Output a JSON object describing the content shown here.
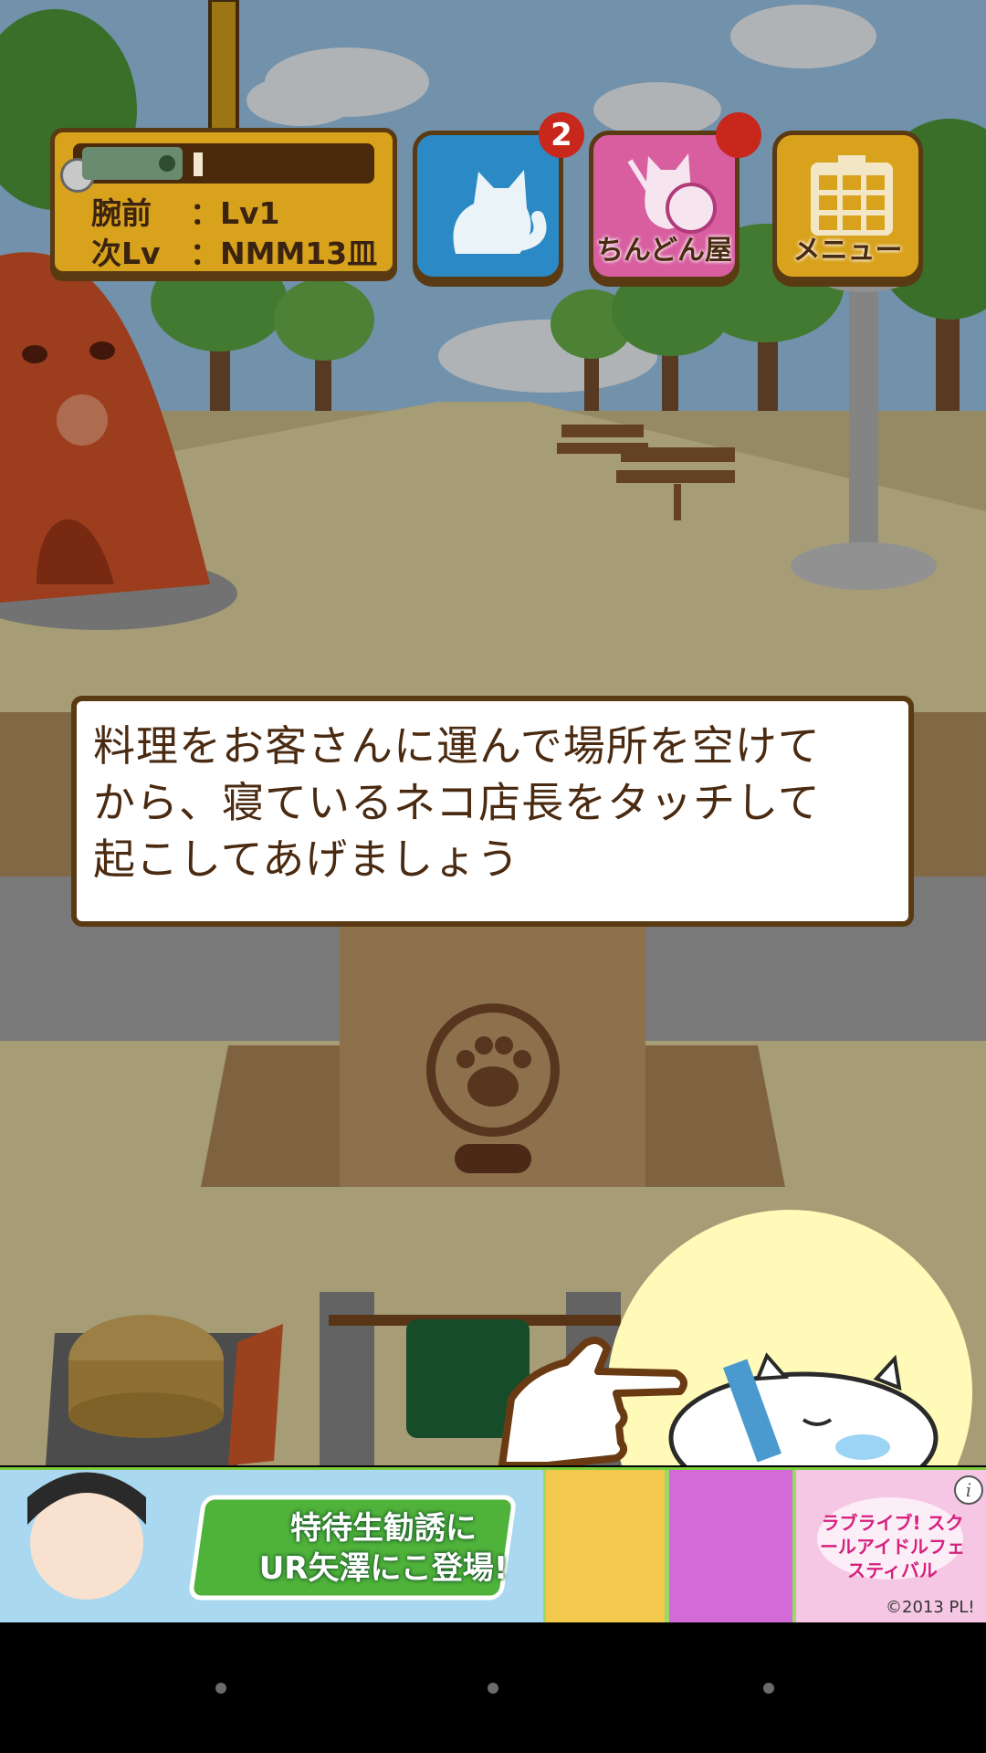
{
  "hud": {
    "status_panel": {
      "skill_label": "腕前",
      "skill_value": "：Lv1",
      "next_label": "次Lv",
      "next_value": "：NMM13皿"
    },
    "cat_button": {
      "badge": "2",
      "icon": "cat-icon"
    },
    "shop_button": {
      "label": "ちんどん屋",
      "icon": "drum-cat-icon"
    },
    "menu_button": {
      "label": "メニュー",
      "icon": "calendar-grid-icon"
    }
  },
  "dialog": {
    "line1": "料理をお客さんに運んで場所を空けて",
    "line2": "から、寝ているネコ店長をタッチして",
    "line3": "起こしてあげましょう"
  },
  "ad": {
    "headline_line1": "特待生勧誘に",
    "headline_line2": "UR矢澤にこ登場!",
    "logo_text": "ラブライブ! スクールアイドルフェスティバル",
    "copyright": "©2013 PL!",
    "info_icon": "info-icon"
  },
  "colors": {
    "sky": "#9fc9ec",
    "dialog_border": "#5a3a12",
    "hud_gold": "#d9a21d",
    "cat_button": "#2b8ac5",
    "shop_button": "#d85ea0",
    "badge_red": "#c8281c",
    "spotlight": "#fffab8"
  }
}
